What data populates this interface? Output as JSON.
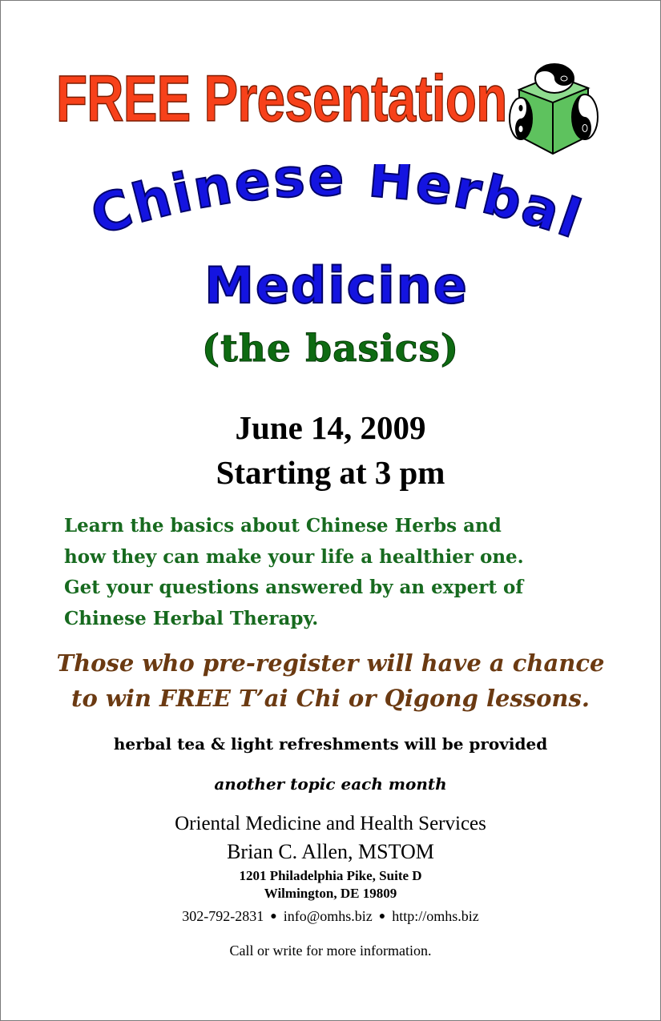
{
  "header": {
    "free_title": "FREE Presentation",
    "logo_icon": "yin-yang-cube-icon"
  },
  "title": {
    "line1": "Chinese Herbal",
    "line2": "Medicine",
    "subtitle": "(the basics)"
  },
  "event": {
    "date": "June 14, 2009",
    "time": "Starting at 3 pm"
  },
  "description": {
    "lines": [
      "Learn the basics about Chinese Herbs and",
      "how they can make your life a healthier one.",
      "Get your questions answered by an expert of",
      "Chinese Herbal Therapy."
    ]
  },
  "promo": {
    "lines": [
      "Those who pre-register will have a chance",
      "to win FREE T’ai Chi or Qigong lessons."
    ]
  },
  "notes": {
    "refreshments": "herbal tea & light refreshments will be provided",
    "topic": "another topic each month"
  },
  "contact": {
    "organization": "Oriental Medicine and Health Services",
    "person": "Brian C. Allen, MSTOM",
    "address_line1": "1201 Philadelphia Pike, Suite D",
    "address_line2": "Wilmington, DE 19809",
    "phone": "302-792-2831",
    "email": "info@omhs.biz",
    "website": "http://omhs.biz",
    "separator": "●",
    "call_to_action": "Call or write for more information."
  },
  "colors": {
    "free_title": "#f7411a",
    "main_title": "#1414e0",
    "subtitle": "#0e6b12",
    "description": "#176a1f",
    "promo": "#6b3a12",
    "logo_cube": "#5ec25e"
  }
}
